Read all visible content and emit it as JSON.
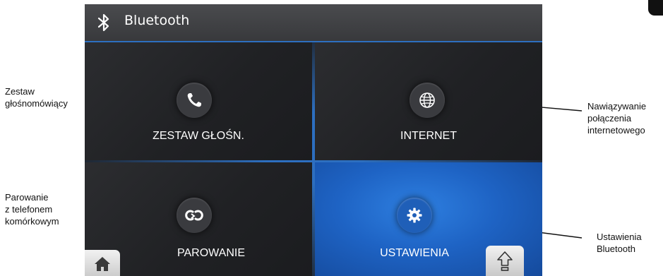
{
  "header": {
    "title": "Bluetooth",
    "icon": "bluetooth-icon"
  },
  "tiles": [
    {
      "label": "ZESTAW GŁOŚN.",
      "icon": "phone-icon"
    },
    {
      "label": "INTERNET",
      "icon": "globe-icon"
    },
    {
      "label": "PAROWANIE",
      "icon": "pairing-link-icon"
    },
    {
      "label": "USTAWIENIA",
      "icon": "gear-icon",
      "selected": true
    }
  ],
  "nav": {
    "home_icon": "home-icon",
    "up_icon": "up-arrow-icon"
  },
  "callouts": [
    {
      "line1": "Zestaw",
      "line2": "głośnomówiący"
    },
    {
      "line1": "Nawiązywanie",
      "line2": "połączenia",
      "line3": "internetowego"
    },
    {
      "line1": "Parowanie",
      "line2": "z telefonem",
      "line3": "komórkowym"
    },
    {
      "line1": "Ustawienia",
      "line2": "Bluetooth"
    }
  ],
  "colors": {
    "accent": "#2d6fc0",
    "selected_tile": "#1e63c4",
    "header": "#414245",
    "tile_bg": "#202124"
  }
}
